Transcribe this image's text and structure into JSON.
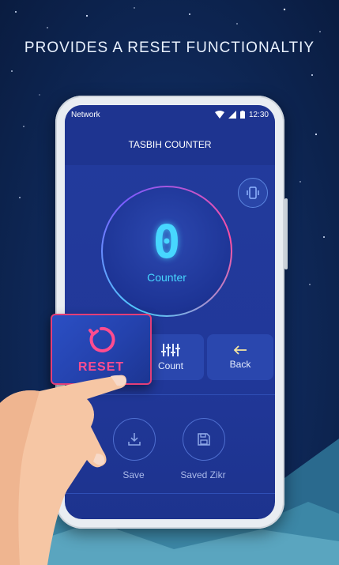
{
  "headline": "PROVIDES A RESET FUNCTIONALTIY",
  "status_bar": {
    "network": "Network",
    "time": "12:30"
  },
  "app_bar": {
    "title": "TASBIH COUNTER"
  },
  "counter": {
    "value": "0",
    "label": "Counter"
  },
  "actions": {
    "reset_label": "RESET",
    "count_label": "Count",
    "back_label": "Back"
  },
  "bottom_actions": {
    "save_label": "Save",
    "saved_label": "Saved Zikr"
  },
  "colors": {
    "accent": "#47d7ff",
    "reset": "#ff4c8f",
    "screen": "#21389a"
  },
  "icons": [
    "reset-icon",
    "equalizer-icon",
    "back-arrow-icon",
    "download-icon",
    "save-icon",
    "vibrate-icon"
  ]
}
